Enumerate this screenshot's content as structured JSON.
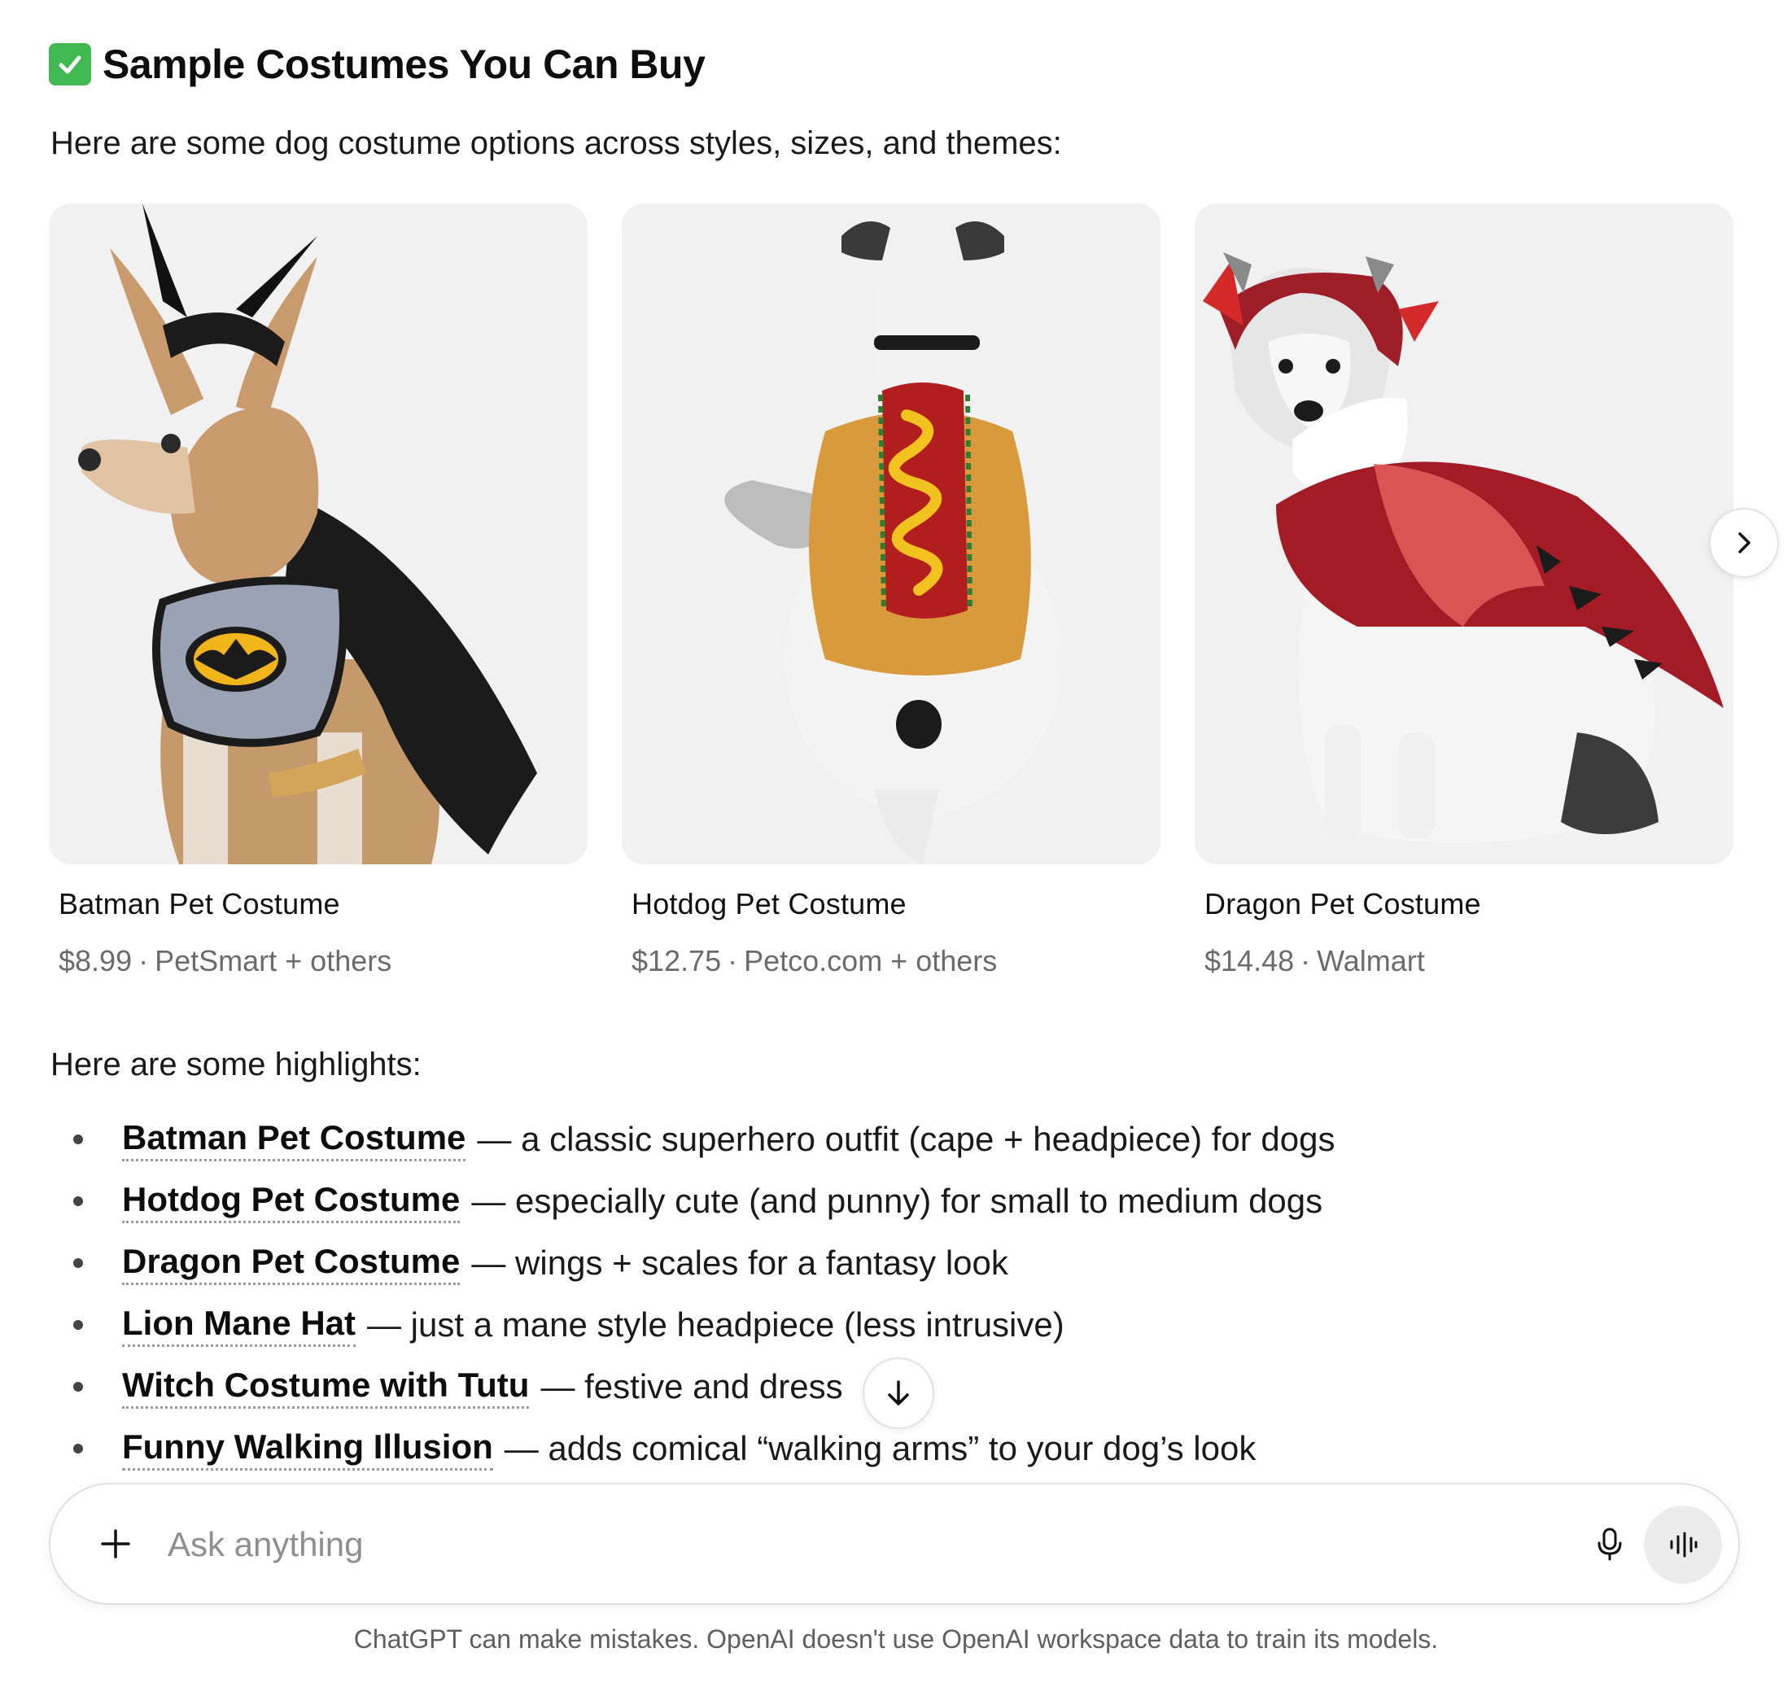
{
  "heading": {
    "icon": "check-mark-button-icon",
    "title": "Sample Costumes You Can Buy"
  },
  "intro": "Here are some dog costume options across styles, sizes, and themes:",
  "products": [
    {
      "name": "Batman Pet Costume",
      "price": "$8.99",
      "separator": "·",
      "seller": "PetSmart + others",
      "image": "dog-in-batman-costume"
    },
    {
      "name": "Hotdog Pet Costume",
      "price": "$12.75",
      "separator": "·",
      "seller": "Petco.com + others",
      "image": "dog-in-hotdog-costume"
    },
    {
      "name": "Dragon Pet Costume",
      "price": "$14.48",
      "separator": "·",
      "seller": "Walmart",
      "image": "dog-in-dragon-costume"
    }
  ],
  "carousel": {
    "next_icon": "chevron-right-icon"
  },
  "highlights_intro": "Here are some highlights:",
  "highlights": [
    {
      "name": "Batman Pet Costume",
      "desc": "— a classic superhero outfit (cape + headpiece) for dogs"
    },
    {
      "name": "Hotdog Pet Costume",
      "desc": "— especially cute (and punny) for small to medium dogs"
    },
    {
      "name": "Dragon Pet Costume",
      "desc": "— wings + scales for a fantasy look"
    },
    {
      "name": "Lion Mane Hat",
      "desc": "— just a mane style headpiece (less intrusive)"
    },
    {
      "name": "Witch Costume with Tutu",
      "desc": "— festive and dress"
    },
    {
      "name": "Funny Walking Illusion",
      "desc": "— adds comical “walking arms” to your dog’s look"
    }
  ],
  "composer": {
    "placeholder": "Ask anything",
    "plus_icon": "plus-icon",
    "mic_icon": "microphone-icon",
    "voice_icon": "voice-mode-icon"
  },
  "disclaimer": "ChatGPT can make mistakes. OpenAI doesn't use OpenAI workspace data to train its models.",
  "colors": {
    "check_green": "#3fb950",
    "muted_text": "#6b6b6b",
    "card_bg": "#f1f1f1"
  }
}
